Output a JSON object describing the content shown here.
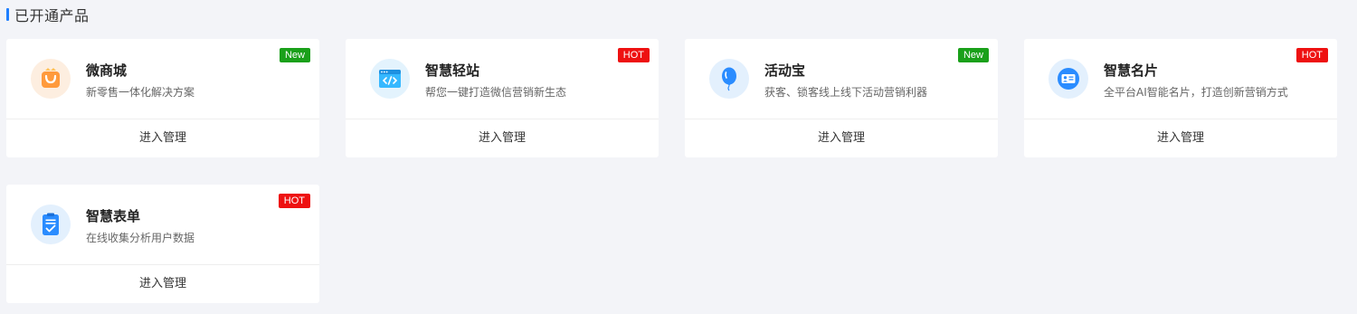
{
  "section": {
    "title": "已开通产品"
  },
  "products": [
    {
      "name": "微商城",
      "description": "新零售一体化解决方案",
      "badge": "New",
      "action": "进入管理",
      "icon": "shopping-bag-icon",
      "accent": "#ff9a3c"
    },
    {
      "name": "智慧轻站",
      "description": "帮您一键打造微信营销新生态",
      "badge": "HOT",
      "action": "进入管理",
      "icon": "code-window-icon",
      "accent": "#35b8ff"
    },
    {
      "name": "活动宝",
      "description": "获客、锁客线上线下活动营销利器",
      "badge": "New",
      "action": "进入管理",
      "icon": "balloon-icon",
      "accent": "#2a8cff"
    },
    {
      "name": "智慧名片",
      "description": "全平台AI智能名片，打造创新营销方式",
      "badge": "HOT",
      "action": "进入管理",
      "icon": "id-card-icon",
      "accent": "#2a8cff"
    },
    {
      "name": "智慧表单",
      "description": "在线收集分析用户数据",
      "badge": "HOT",
      "action": "进入管理",
      "icon": "clipboard-check-icon",
      "accent": "#2a8cff"
    }
  ],
  "colors": {
    "new_badge": "#1aa01a",
    "hot_badge": "#ee1111",
    "section_bar": "#1f7fff",
    "background": "#f3f4f8"
  }
}
